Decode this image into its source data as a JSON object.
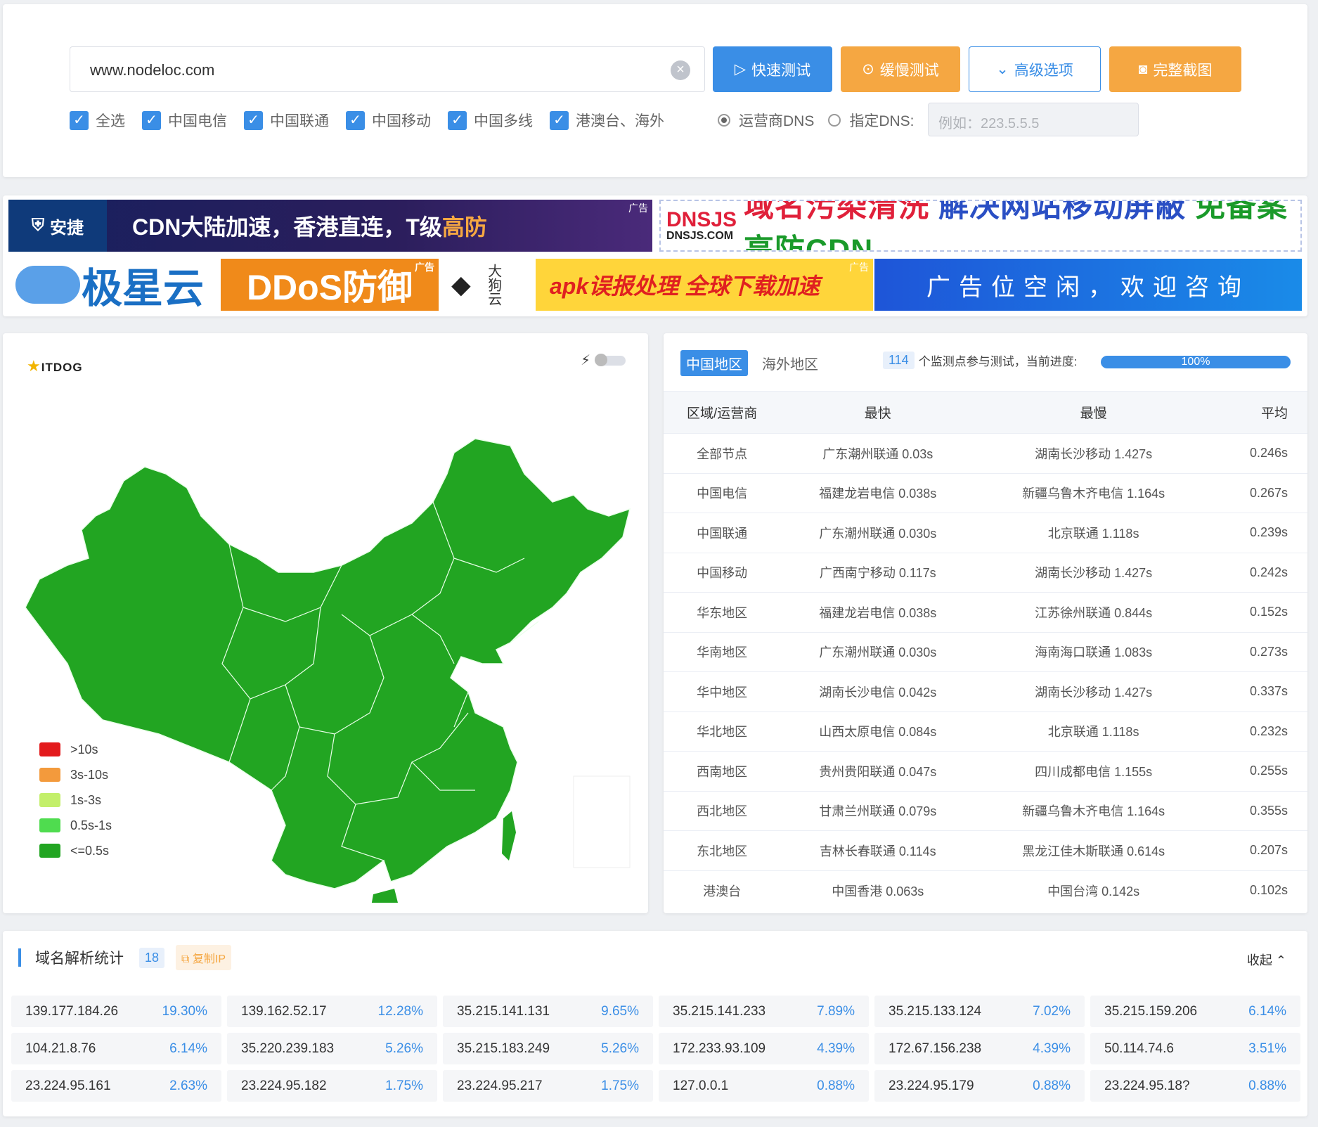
{
  "search": {
    "url": "www.nodeloc.com",
    "buttons": {
      "quick": "快速测试",
      "slow": "缓慢测试",
      "advanced": "高级选项",
      "screenshot": "完整截图"
    },
    "checks": [
      "全选",
      "中国电信",
      "中国联通",
      "中国移动",
      "中国多线",
      "港澳台、海外"
    ],
    "dns_radio": {
      "isp": "运营商DNS",
      "custom": "指定DNS:"
    },
    "dns_placeholder": "例如：223.5.5.5"
  },
  "ads": {
    "tag": "广告",
    "ad1": {
      "brand": "安捷",
      "text": "CDN大陆加速，香港直连，T级",
      "highlight": "高防"
    },
    "ad2": {
      "logo_top": "DNSJS",
      "logo_bottom": "DNSJS.COM",
      "text1": "域名污染清洗",
      "text2": "解决网站移动屏蔽",
      "text3": "免备案高防CDN"
    },
    "ad3": {
      "brand": "极星云",
      "text": "DDoS防御"
    },
    "ad4": {
      "brand": "大狗云"
    },
    "ad5": {
      "text": "apk误报处理 全球下载加速"
    },
    "ad6": {
      "text": "广告位空闲，欢迎咨询"
    }
  },
  "map": {
    "logo": "ITDOG",
    "legend": [
      {
        "label": ">10s",
        "color": "#e31a1c"
      },
      {
        "label": "3s-10s",
        "color": "#f39a3c"
      },
      {
        "label": "1s-3s",
        "color": "#c3ef6a"
      },
      {
        "label": "0.5s-1s",
        "color": "#4fdc4f"
      },
      {
        "label": "<=0.5s",
        "color": "#22a522"
      }
    ]
  },
  "stats": {
    "tabs": [
      "中国地区",
      "海外地区"
    ],
    "monitor_count": "114",
    "monitor_text": "个监测点参与测试，当前进度:",
    "progress": "100%",
    "headers": [
      "区域/运营商",
      "最快",
      "最慢",
      "平均"
    ],
    "rows": [
      [
        "全部节点",
        "广东潮州联通 0.03s",
        "湖南长沙移动 1.427s",
        "0.246s"
      ],
      [
        "中国电信",
        "福建龙岩电信 0.038s",
        "新疆乌鲁木齐电信 1.164s",
        "0.267s"
      ],
      [
        "中国联通",
        "广东潮州联通 0.030s",
        "北京联通 1.118s",
        "0.239s"
      ],
      [
        "中国移动",
        "广西南宁移动 0.117s",
        "湖南长沙移动 1.427s",
        "0.242s"
      ],
      [
        "华东地区",
        "福建龙岩电信 0.038s",
        "江苏徐州联通 0.844s",
        "0.152s"
      ],
      [
        "华南地区",
        "广东潮州联通 0.030s",
        "海南海口联通 1.083s",
        "0.273s"
      ],
      [
        "华中地区",
        "湖南长沙电信 0.042s",
        "湖南长沙移动 1.427s",
        "0.337s"
      ],
      [
        "华北地区",
        "山西太原电信 0.084s",
        "北京联通 1.118s",
        "0.232s"
      ],
      [
        "西南地区",
        "贵州贵阳联通 0.047s",
        "四川成都电信 1.155s",
        "0.255s"
      ],
      [
        "西北地区",
        "甘肃兰州联通 0.079s",
        "新疆乌鲁木齐电信 1.164s",
        "0.355s"
      ],
      [
        "东北地区",
        "吉林长春联通 0.114s",
        "黑龙江佳木斯联通 0.614s",
        "0.207s"
      ],
      [
        "港澳台",
        "中国香港 0.063s",
        "中国台湾 0.142s",
        "0.102s"
      ]
    ]
  },
  "dns": {
    "title": "域名解析统计",
    "count": "18",
    "copy": "复制IP",
    "collapse": "收起",
    "ips": [
      [
        "139.177.184.26",
        "19.30%"
      ],
      [
        "139.162.52.17",
        "12.28%"
      ],
      [
        "35.215.141.131",
        "9.65%"
      ],
      [
        "35.215.141.233",
        "7.89%"
      ],
      [
        "35.215.133.124",
        "7.02%"
      ],
      [
        "35.215.159.206",
        "6.14%"
      ],
      [
        "104.21.8.76",
        "6.14%"
      ],
      [
        "35.220.239.183",
        "5.26%"
      ],
      [
        "35.215.183.249",
        "5.26%"
      ],
      [
        "172.233.93.109",
        "4.39%"
      ],
      [
        "172.67.156.238",
        "4.39%"
      ],
      [
        "50.114.74.6",
        "3.51%"
      ],
      [
        "23.224.95.161",
        "2.63%"
      ],
      [
        "23.224.95.182",
        "1.75%"
      ],
      [
        "23.224.95.217",
        "1.75%"
      ],
      [
        "127.0.0.1",
        "0.88%"
      ],
      [
        "23.224.95.179",
        "0.88%"
      ],
      [
        "23.224.95.18?",
        "0.88%"
      ]
    ]
  }
}
